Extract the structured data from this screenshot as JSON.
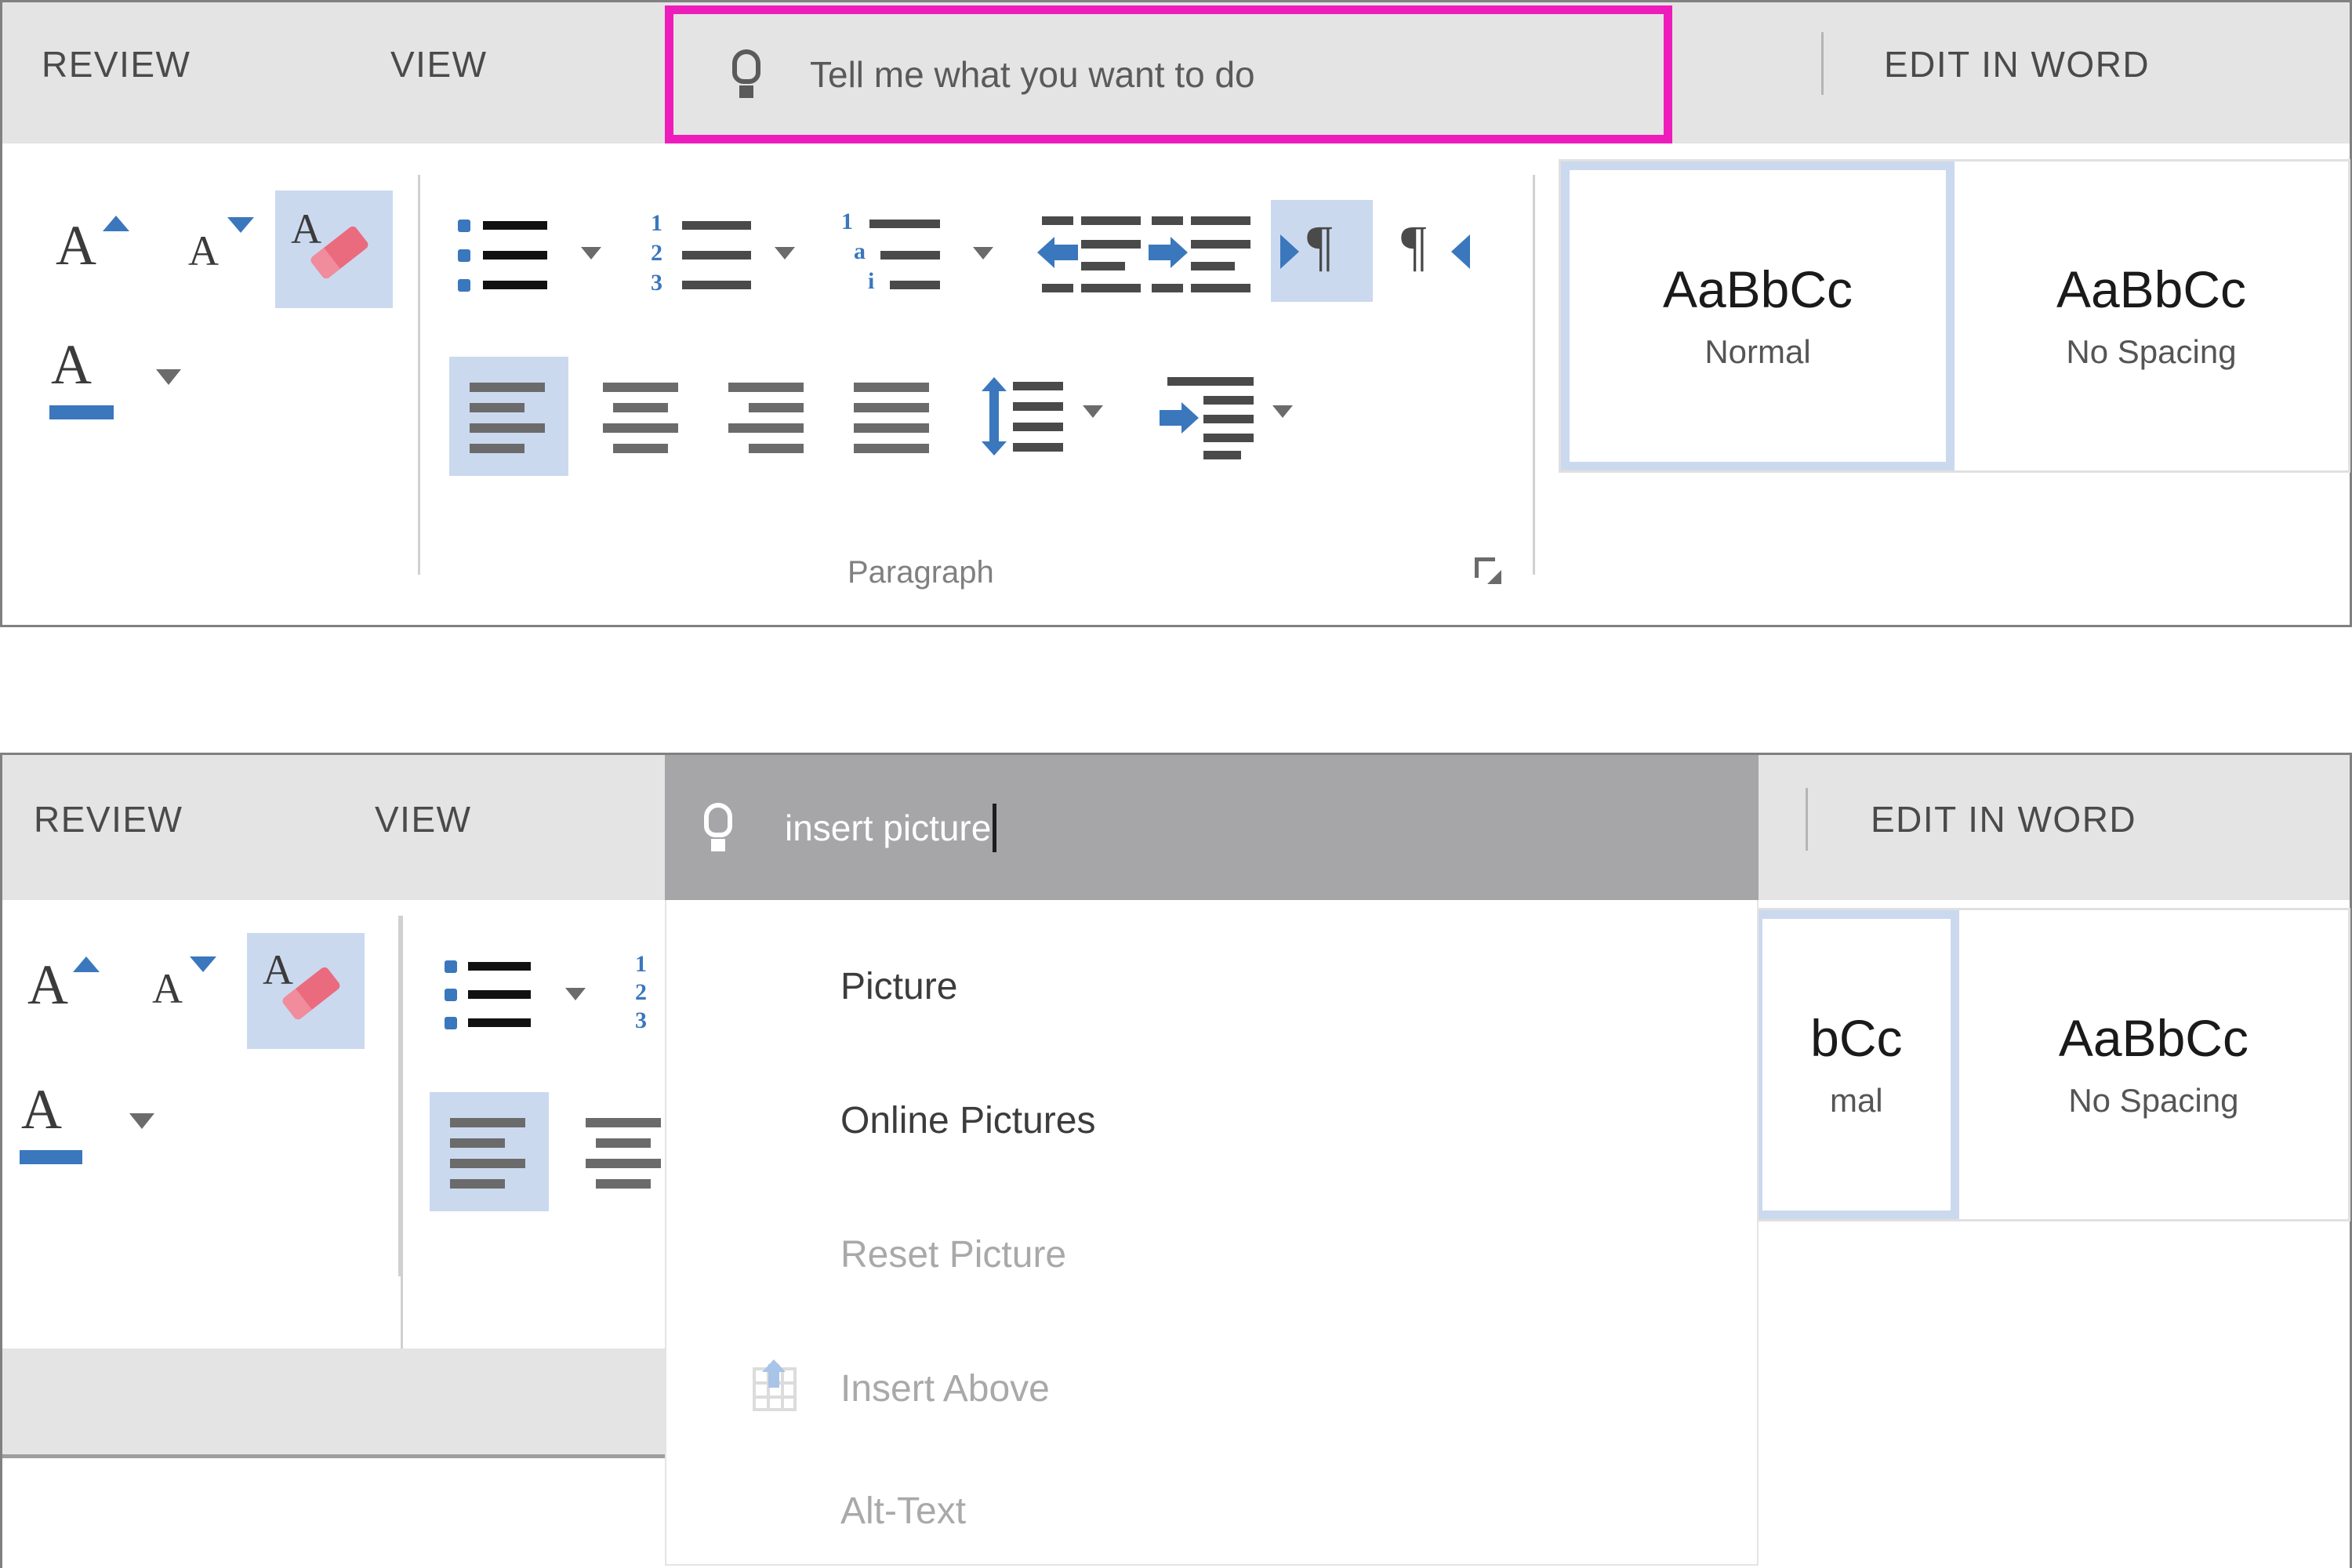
{
  "top_panel": {
    "tabs": [
      {
        "label": "REVIEW"
      },
      {
        "label": "VIEW"
      }
    ],
    "tell_me": {
      "icon": "lightbulb-icon",
      "placeholder": "Tell me what you want to do",
      "highlight_color": "#ee1cbb"
    },
    "edit_in_word_label": "EDIT IN WORD",
    "font_group": {
      "buttons": [
        {
          "name": "grow-font",
          "glyph": "A"
        },
        {
          "name": "shrink-font",
          "glyph": "A"
        },
        {
          "name": "clear-formatting",
          "glyph": "A",
          "selected": true
        },
        {
          "name": "font-color",
          "glyph": "A"
        }
      ]
    },
    "paragraph_group": {
      "label": "Paragraph",
      "buttons": [
        {
          "name": "bullets"
        },
        {
          "name": "numbering"
        },
        {
          "name": "multilevel-list"
        },
        {
          "name": "decrease-indent"
        },
        {
          "name": "increase-indent"
        },
        {
          "name": "left-to-right-text-direction",
          "selected": true
        },
        {
          "name": "right-to-left-text-direction"
        },
        {
          "name": "align-left",
          "selected": true
        },
        {
          "name": "align-center"
        },
        {
          "name": "align-right"
        },
        {
          "name": "justify"
        },
        {
          "name": "line-spacing"
        },
        {
          "name": "increase-indent-2"
        }
      ]
    },
    "styles": [
      {
        "sample": "AaBbCc",
        "name": "Normal",
        "selected": true
      },
      {
        "sample": "AaBbCc",
        "name": "No Spacing",
        "selected": false
      }
    ]
  },
  "bottom_panel": {
    "tabs": [
      {
        "label": "REVIEW"
      },
      {
        "label": "VIEW"
      }
    ],
    "tell_me": {
      "icon": "lightbulb-icon",
      "value": "insert picture"
    },
    "edit_in_word_label": "EDIT IN WORD",
    "dropdown_results": [
      {
        "label": "Picture",
        "disabled": false,
        "icon": null
      },
      {
        "label": "Online Pictures",
        "disabled": false,
        "icon": null
      },
      {
        "label": "Reset Picture",
        "disabled": true,
        "icon": null
      },
      {
        "label": "Insert Above",
        "disabled": true,
        "icon": "table-insert-above-icon"
      },
      {
        "label": "Alt-Text",
        "disabled": true,
        "icon": null
      }
    ],
    "styles": [
      {
        "sample": "bCc",
        "name": "mal",
        "selected": true
      },
      {
        "sample": "AaBbCc",
        "name": "No Spacing",
        "selected": false
      }
    ]
  }
}
